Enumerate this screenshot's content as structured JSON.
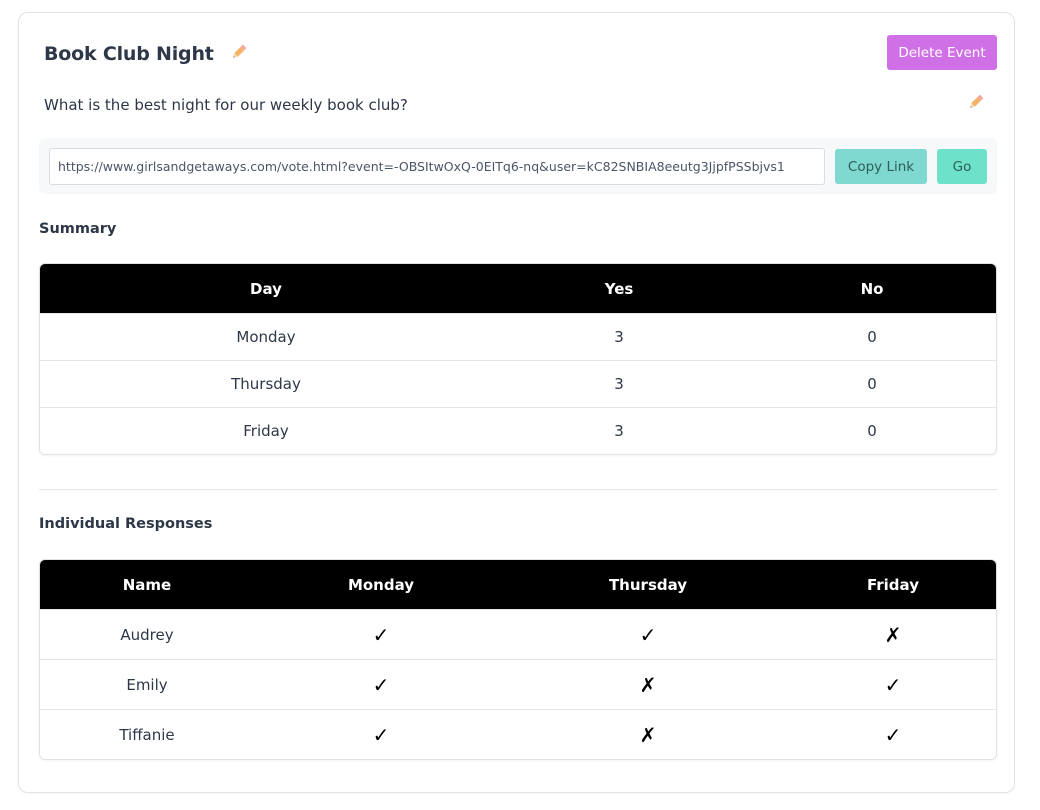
{
  "event": {
    "title": "Book Club Night",
    "description": "What is the best night for our weekly book club?",
    "delete_label": "Delete Event"
  },
  "link": {
    "url": "https://www.girlsandgetaways.com/vote.html?event=-OBSItwOxQ-0EITq6-nq&user=kC82SNBIA8eeutg3JjpfPSSbjvs1",
    "copy_label": "Copy Link",
    "go_label": "Go"
  },
  "summary": {
    "heading": "Summary",
    "columns": [
      "Day",
      "Yes",
      "No"
    ],
    "rows": [
      {
        "day": "Monday",
        "yes": "3",
        "no": "0"
      },
      {
        "day": "Thursday",
        "yes": "3",
        "no": "0"
      },
      {
        "day": "Friday",
        "yes": "3",
        "no": "0"
      }
    ]
  },
  "responses": {
    "heading": "Individual Responses",
    "columns": [
      "Name",
      "Monday",
      "Thursday",
      "Friday"
    ],
    "rows": [
      {
        "name": "Audrey",
        "monday": "✓",
        "thursday": "✓",
        "friday": "✗"
      },
      {
        "name": "Emily",
        "monday": "✓",
        "thursday": "✗",
        "friday": "✓"
      },
      {
        "name": "Tiffanie",
        "monday": "✓",
        "thursday": "✗",
        "friday": "✓"
      }
    ]
  },
  "icons": {
    "title_edit": "pencil-icon",
    "description_edit": "pencil-icon"
  },
  "colors": {
    "delete_button": "#d070e6",
    "copy_button": "#7fd9d1",
    "go_button": "#6ee2c8",
    "table_header": "#000000",
    "pencil": "#f4a460"
  }
}
